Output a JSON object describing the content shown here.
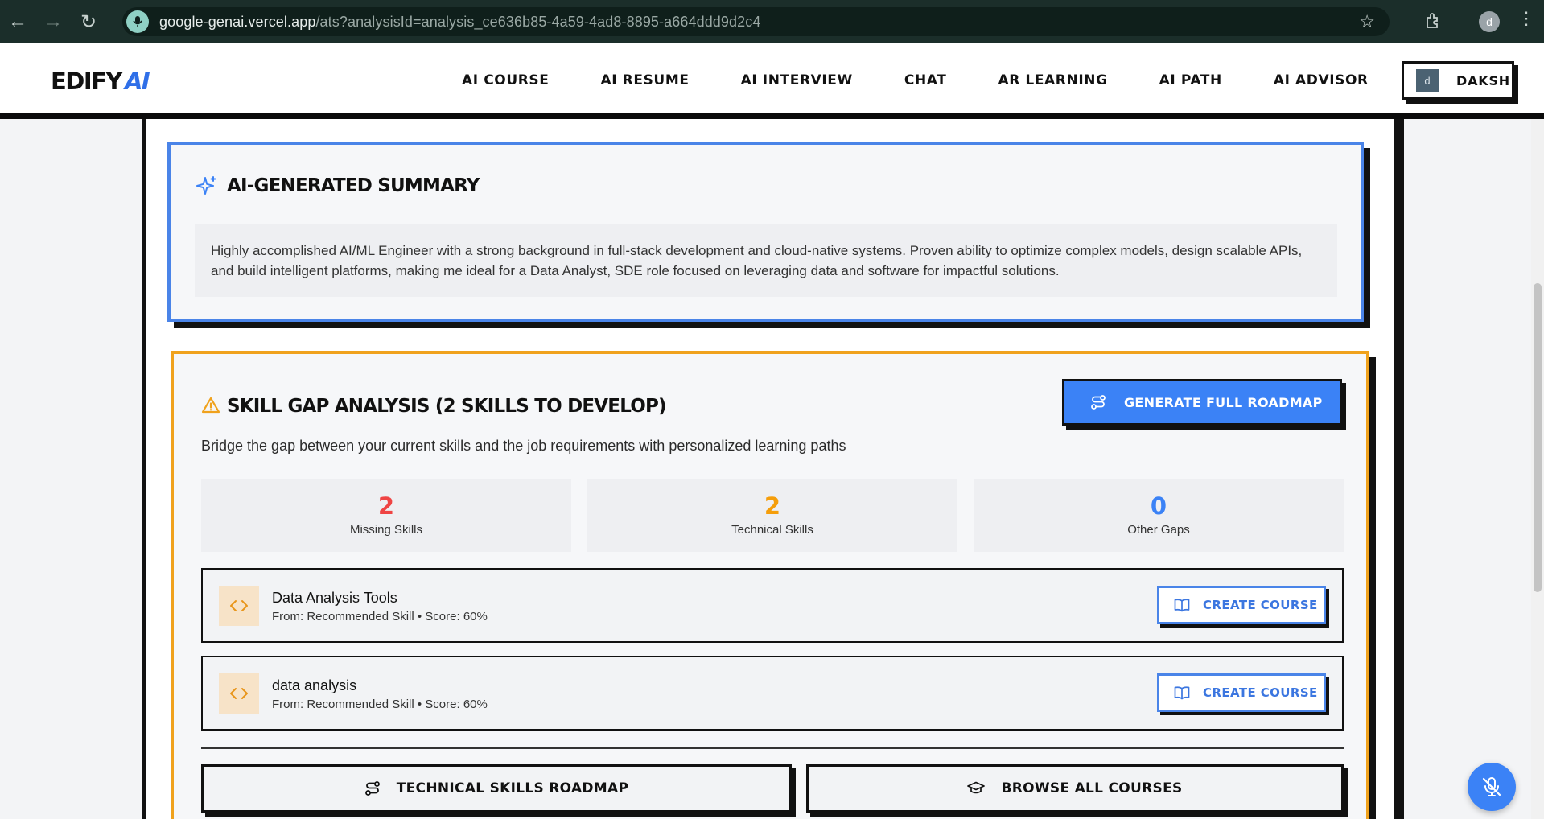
{
  "browser": {
    "url_host": "google-genai.vercel.app",
    "url_path": "/ats?analysisId=analysis_ce636b85-4a59-4ad8-8895-a664ddd9d2c4",
    "profile_initial": "d"
  },
  "header": {
    "logo_main": "EDIFY",
    "logo_accent": "AI",
    "nav": [
      "AI COURSE",
      "AI RESUME",
      "AI INTERVIEW",
      "CHAT",
      "AR LEARNING",
      "AI PATH",
      "AI ADVISOR"
    ],
    "user_initial": "d",
    "user_name": "DAKSH"
  },
  "summary": {
    "title": "AI-GENERATED SUMMARY",
    "text": "Highly accomplished AI/ML Engineer with a strong background in full-stack development and cloud-native systems. Proven ability to optimize complex models, design scalable APIs, and build intelligent platforms, making me ideal for a Data Analyst, SDE role focused on leveraging data and software for impactful solutions."
  },
  "skill_gap": {
    "title": "SKILL GAP ANALYSIS (2 SKILLS TO DEVELOP)",
    "subtitle": "Bridge the gap between your current skills and the job requirements with personalized learning paths",
    "roadmap_button": "GENERATE FULL ROADMAP",
    "stats": [
      {
        "value": "2",
        "label": "Missing Skills",
        "color": "#ef4444"
      },
      {
        "value": "2",
        "label": "Technical Skills",
        "color": "#f59e0b"
      },
      {
        "value": "0",
        "label": "Other Gaps",
        "color": "#3b82f6"
      }
    ],
    "skills": [
      {
        "name": "Data Analysis Tools",
        "meta": "From: Recommended Skill • Score: 60%",
        "button": "CREATE COURSE"
      },
      {
        "name": "data analysis",
        "meta": "From: Recommended Skill • Score: 60%",
        "button": "CREATE COURSE"
      }
    ],
    "technical_roadmap_button": "TECHNICAL SKILLS ROADMAP",
    "browse_courses_button": "BROWSE ALL COURSES"
  },
  "colors": {
    "accent_blue": "#3b82f6",
    "summary_border": "#4a84e8",
    "gap_border": "#f0a21d"
  }
}
